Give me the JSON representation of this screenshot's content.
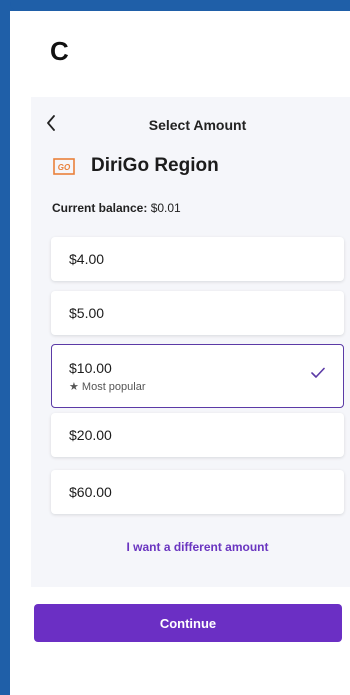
{
  "page": {
    "letter": "C"
  },
  "header": {
    "title": "Select Amount",
    "back_icon": "chevron-left-icon"
  },
  "agency": {
    "name": "DiriGo Region",
    "logo_text": "GO",
    "logo_color": "#e9813b"
  },
  "balance": {
    "label": "Current balance:",
    "value": "$0.01"
  },
  "amounts": [
    {
      "label": "$4.00"
    },
    {
      "label": "$5.00"
    },
    {
      "label": "$10.00",
      "tag": "★ Most popular",
      "selected": true
    },
    {
      "label": "$20.00"
    },
    {
      "label": "$60.00"
    }
  ],
  "different_amount_link": "I want a different amount",
  "continue_label": "Continue",
  "colors": {
    "accent": "#6b2fc4",
    "frame": "#1f5fa8",
    "panel": "#f5f6fa"
  }
}
